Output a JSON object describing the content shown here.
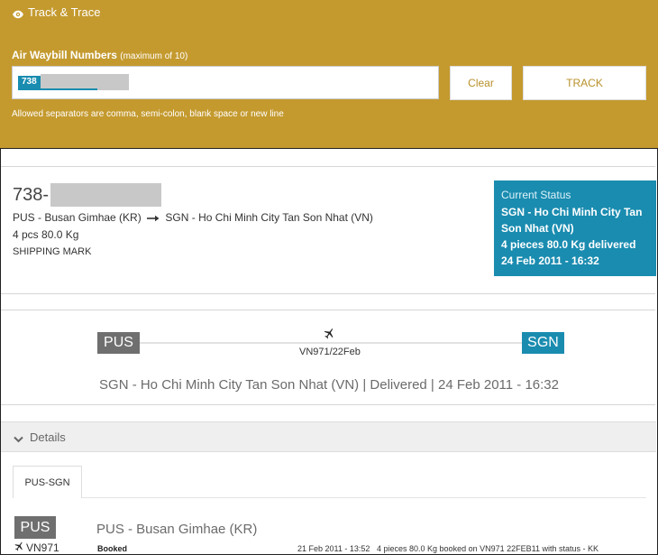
{
  "tracker": {
    "title": "Track & Trace",
    "awb_label": "Air Waybill Numbers",
    "awb_label_note": "(maximum of 10)",
    "awb_token_prefix": "738",
    "clear_label": "Clear",
    "track_label": "TRACK",
    "hint": "Allowed separators are comma, semi-colon, blank space or new line"
  },
  "shipment": {
    "awb_prefix": "738-",
    "origin_full": "PUS - Busan Gimhae (KR)",
    "destination_full": "SGN - Ho Chi Minh City Tan Son Nhat (VN)",
    "pieces": "4 pcs 80.0 Kg",
    "mark": "SHIPPING MARK"
  },
  "current_status": {
    "heading": "Current Status",
    "location": "SGN - Ho Chi Minh City Tan Son Nhat (VN)",
    "detail": "4 pieces 80.0 Kg delivered",
    "datetime": "24 Feb 2011 - 16:32"
  },
  "route": {
    "origin_code": "PUS",
    "destination_code": "SGN",
    "flight": "VN971/22Feb",
    "arrival_summary": "SGN - Ho Chi Minh City Tan Son Nhat (VN) | Delivered | 24 Feb 2011 - 16:32"
  },
  "details": {
    "label": "Details",
    "tab_label": "PUS-SGN",
    "segment": {
      "code": "PUS",
      "flight": "VN971",
      "airport": "PUS - Busan Gimhae (KR)",
      "status": "Booked",
      "time": "21 Feb 2011 - 13:52",
      "description": "4 pieces 80.0 Kg booked on VN971 22FEB11 with status - KK"
    }
  },
  "colors": {
    "panel": "#c49a2f",
    "accent": "#1a8cb0",
    "origin_grey": "#6f6f6f"
  }
}
